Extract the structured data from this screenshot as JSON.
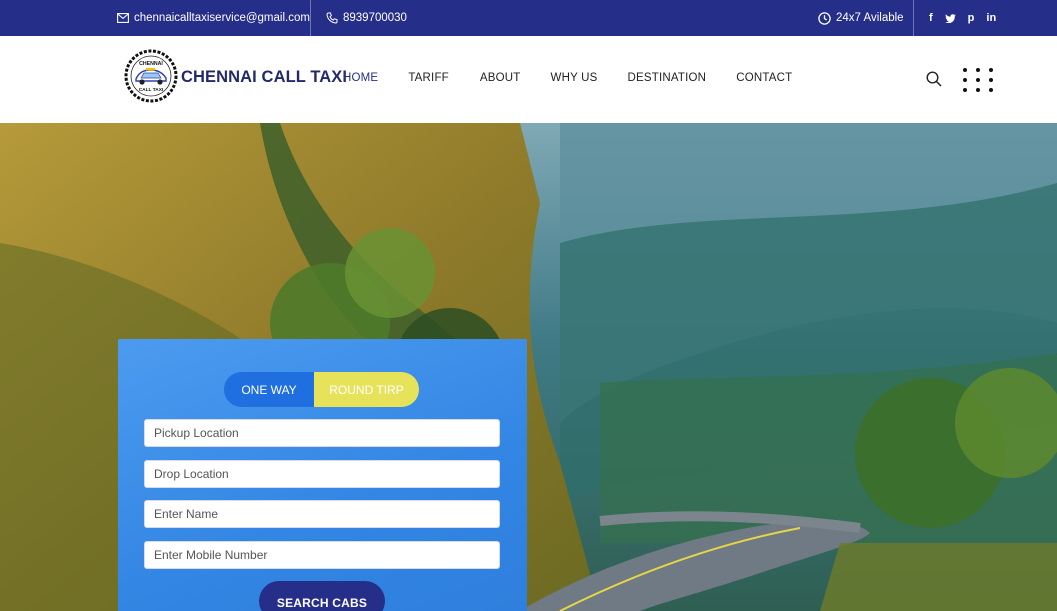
{
  "topbar": {
    "email": "chennaicalltaxiservice@gmail.com",
    "phone": "8939700030",
    "availability": "24x7 Avilable",
    "social": [
      "f",
      "t",
      "p",
      "in"
    ]
  },
  "header": {
    "brand": "CHENNAI CALL TAXI",
    "logo_text_top": "CHENNAI",
    "logo_text_bottom": "CALL TAXI",
    "nav": [
      "HOME",
      "TARIFF",
      "ABOUT",
      "WHY US",
      "DESTINATION",
      "CONTACT"
    ]
  },
  "booking": {
    "tab_one_way": "ONE WAY",
    "tab_round_trip": "ROUND TIRP",
    "pickup_placeholder": "Pickup Location",
    "drop_placeholder": "Drop Location",
    "name_placeholder": "Enter Name",
    "mobile_placeholder": "Enter Mobile Number",
    "search_label": "SEARCH CABS"
  },
  "colors": {
    "brand_navy": "#252f8a",
    "card_blue": "#3a8de6",
    "tab_blue": "#1f6fe0",
    "tab_yellow": "#e6e35a"
  },
  "icons": [
    "email-icon",
    "phone-icon",
    "clock-icon",
    "facebook-icon",
    "twitter-icon",
    "pinterest-icon",
    "linkedin-icon",
    "search-icon",
    "grid-menu-icon"
  ]
}
